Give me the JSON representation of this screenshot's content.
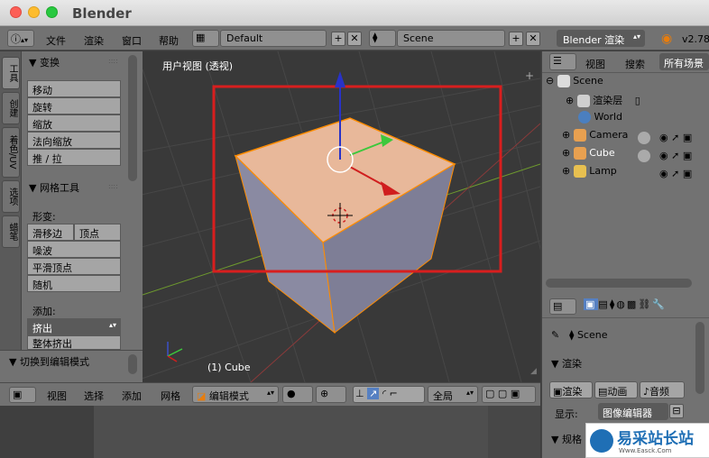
{
  "window": {
    "title": "Blender"
  },
  "infobar": {
    "menus": [
      "文件",
      "渲染",
      "窗口",
      "帮助"
    ],
    "layout": "Default",
    "scene": "Scene",
    "engine": "Blender 渲染",
    "version": "v2.78"
  },
  "toolshelf": {
    "tabs": [
      "工具",
      "创建",
      "着色/UV",
      "选项",
      "蜡笔"
    ],
    "transform": {
      "title": "▼ 变换",
      "buttons": [
        "移动",
        "旋转",
        "缩放",
        "法向缩放",
        "推 / 拉"
      ]
    },
    "mesh_tools": {
      "title": "▼ 网格工具",
      "deform_label": "形变:",
      "slide_edge": "滑移边",
      "vertex": "顶点",
      "buttons": [
        "噪波",
        "平滑顶点",
        "随机"
      ],
      "add_label": "添加:",
      "extrude": "挤出",
      "extrude_all": "整体挤出"
    },
    "toggle_edit": "▼ 切换到编辑模式"
  },
  "viewport": {
    "view_label": "用户视图 (透视)",
    "object_label": "(1) Cube"
  },
  "viewport_header": {
    "menus": [
      "视图",
      "选择",
      "添加",
      "网格"
    ],
    "mode": "编辑模式",
    "orientation": "全局"
  },
  "outliner": {
    "view": "视图",
    "search": "搜索",
    "filter": "所有场景",
    "items": [
      {
        "label": "Scene",
        "icon": "scene-icon"
      },
      {
        "label": "渲染层",
        "icon": "render-layer-icon"
      },
      {
        "label": "World",
        "icon": "world-icon"
      },
      {
        "label": "Camera",
        "icon": "camera-icon"
      },
      {
        "label": "Cube",
        "icon": "mesh-icon"
      },
      {
        "label": "Lamp",
        "icon": "lamp-icon"
      }
    ]
  },
  "properties": {
    "scene_label": "Scene",
    "render_panel": "▼ 渲染",
    "render_btn": "渲染",
    "anim_btn": "动画",
    "audio_btn": "音频",
    "display_label": "显示:",
    "display_value": "图像编辑器",
    "dimensions_panel": "▼ 规格"
  },
  "watermark": {
    "text": "易采站长站",
    "url_text": "Www.Easck.Com"
  },
  "colors": {
    "selection_outline": "#d81e1e",
    "object_face": "#e8b89a",
    "mesh_edge": "#ff8c00",
    "accent_blue": "#5680c2"
  }
}
